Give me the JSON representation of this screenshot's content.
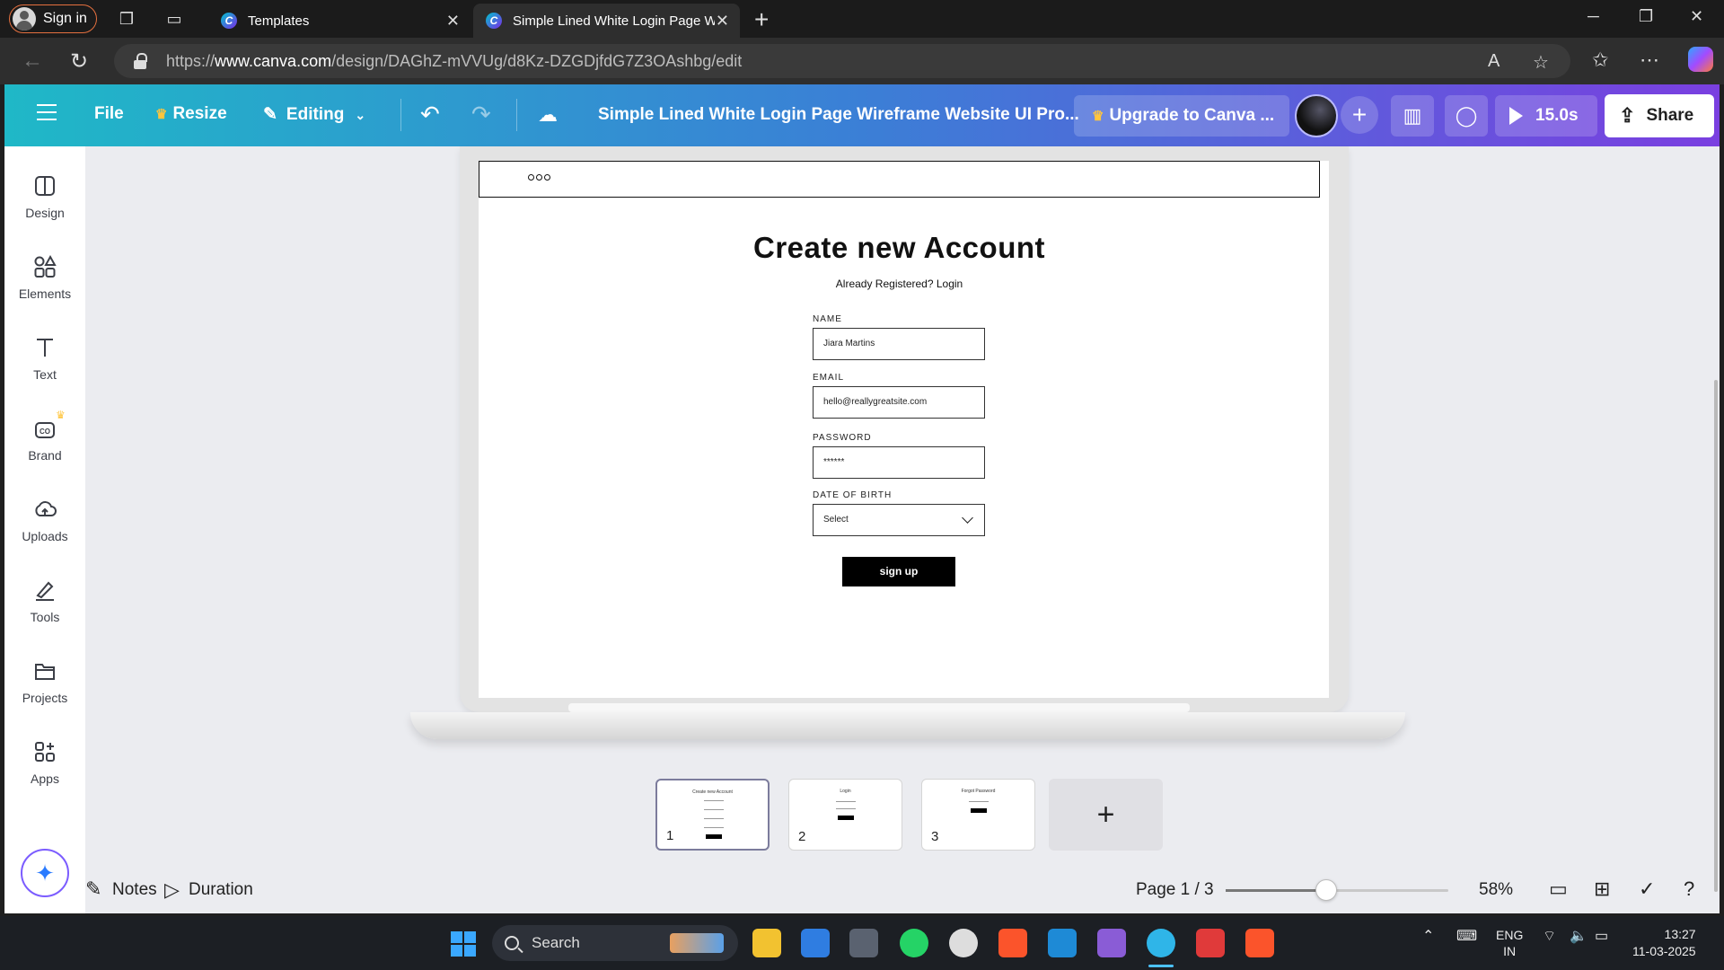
{
  "browser": {
    "signin_label": "Sign in",
    "tabs": [
      {
        "title": "Templates"
      },
      {
        "title": "Simple Lined White Login Page Wireframe Website UI Prototype"
      }
    ],
    "url_prefix": "https://",
    "url_host": "www.canva.com",
    "url_path": "/design/DAGhZ-mVVUg/d8Kz-DZGDjfdG7Z3OAshbg/edit"
  },
  "canva_header": {
    "file": "File",
    "resize": "Resize",
    "editing": "Editing",
    "doc_title": "Simple Lined White Login Page Wireframe Website UI Pro...",
    "upgrade": "Upgrade to Canva ...",
    "play_duration": "15.0s",
    "share": "Share",
    "brand_gradient": [
      "#1fb8c7",
      "#3b7fd6",
      "#7a3fe0"
    ]
  },
  "sidebar": {
    "items": [
      {
        "label": "Design",
        "icon": "layout-icon"
      },
      {
        "label": "Elements",
        "icon": "shapes-icon"
      },
      {
        "label": "Text",
        "icon": "text-icon"
      },
      {
        "label": "Brand",
        "icon": "brand-icon"
      },
      {
        "label": "Uploads",
        "icon": "cloud-upload-icon"
      },
      {
        "label": "Tools",
        "icon": "pen-tool-icon"
      },
      {
        "label": "Projects",
        "icon": "folder-icon"
      },
      {
        "label": "Apps",
        "icon": "apps-icon"
      }
    ]
  },
  "design": {
    "title": "Create new Account",
    "subtitle": "Already Registered? Login",
    "fields": [
      {
        "label": "NAME",
        "value": "Jiara Martins"
      },
      {
        "label": "EMAIL",
        "value": "hello@reallygreatsite.com"
      },
      {
        "label": "PASSWORD",
        "value": "******"
      },
      {
        "label": "DATE OF BIRTH",
        "value": "Select"
      }
    ],
    "button": "sign up"
  },
  "pages": {
    "thumbs": [
      {
        "num": "1",
        "mini_title": "Create new Account"
      },
      {
        "num": "2",
        "mini_title": "Login"
      },
      {
        "num": "3",
        "mini_title": "Forgot Password"
      }
    ],
    "add": "+"
  },
  "bottombar": {
    "notes": "Notes",
    "duration": "Duration",
    "page_indicator": "Page 1 / 3",
    "zoom": "58%",
    "zoom_level": 0.45
  },
  "taskbar": {
    "search": "Search",
    "lang1": "ENG",
    "lang2": "IN",
    "time": "13:27",
    "date": "11-03-2025"
  }
}
